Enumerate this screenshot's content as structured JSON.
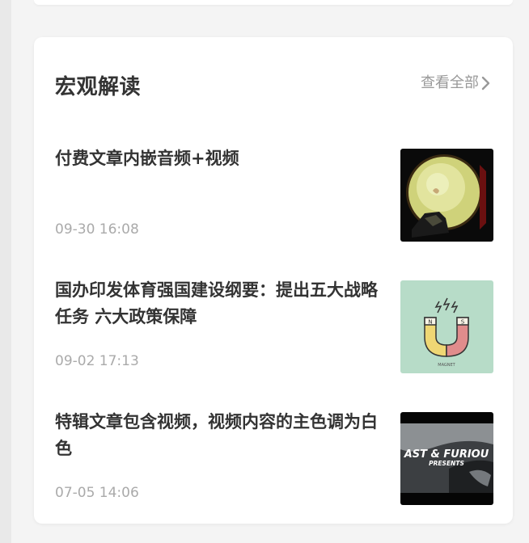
{
  "section": {
    "title": "宏观解读",
    "view_all_label": "查看全部"
  },
  "articles": [
    {
      "title": "付费文章内嵌音频+视频",
      "time": "09-30 16:08",
      "thumbnail": "drum-image"
    },
    {
      "title": "国办印发体育强国建设纲要：提出五大战略任务 六大政策保障",
      "time": "09-02 17:13",
      "thumbnail": "magnet-image",
      "thumbnail_text": "MAGNET"
    },
    {
      "title": "特辑文章包含视频，视频内容的主色调为白色",
      "time": "07-05 14:06",
      "thumbnail": "movie-poster-image",
      "thumbnail_text_1": "AST & FURIOU",
      "thumbnail_text_2": "PRESENTS"
    }
  ],
  "colors": {
    "title_text": "#333333",
    "meta_text": "#aaaaaa",
    "link_text": "#999999",
    "card_bg": "#ffffff",
    "page_bg": "#f4f4f4"
  }
}
